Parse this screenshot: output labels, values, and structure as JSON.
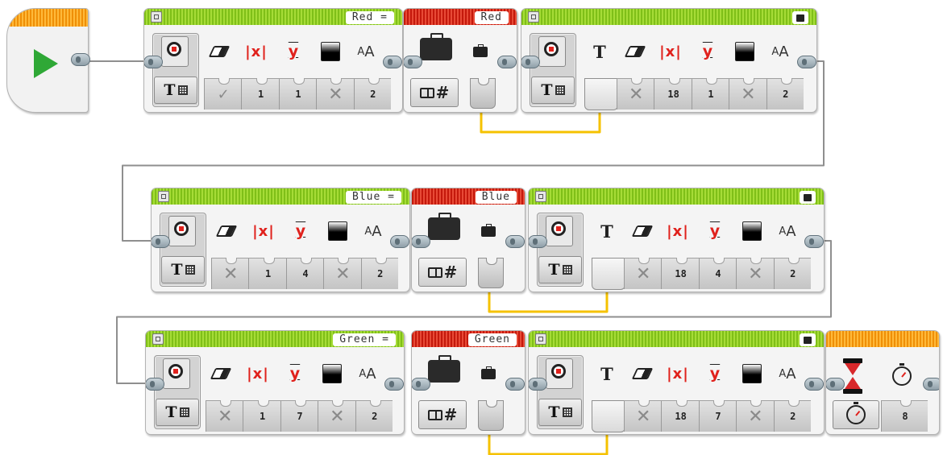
{
  "program": {
    "start_block": {
      "icon": "play-icon"
    },
    "rows": [
      {
        "display_a": {
          "header": "Red =",
          "params": [
            "✓",
            "1",
            "1",
            "✕",
            "2"
          ]
        },
        "variable": {
          "name": "Red"
        },
        "display_b": {
          "params": [
            "✕",
            "18",
            "1",
            "✕",
            "2"
          ]
        }
      },
      {
        "display_a": {
          "header": "Blue =",
          "params": [
            "✕",
            "1",
            "4",
            "✕",
            "2"
          ]
        },
        "variable": {
          "name": "Blue"
        },
        "display_b": {
          "params": [
            "✕",
            "18",
            "4",
            "✕",
            "2"
          ]
        }
      },
      {
        "display_a": {
          "header": "Green =",
          "params": [
            "✕",
            "1",
            "7",
            "✕",
            "2"
          ]
        },
        "variable": {
          "name": "Green"
        },
        "display_b": {
          "params": [
            "✕",
            "18",
            "7",
            "✕",
            "2"
          ]
        }
      }
    ],
    "wait_block": {
      "seconds": "8"
    }
  },
  "icons": {
    "display_a_icons": [
      "eraser-icon",
      "x-position-icon",
      "y-position-icon",
      "color-icon",
      "font-size-icon"
    ],
    "display_b_icons": [
      "text-icon",
      "eraser-icon",
      "x-position-icon",
      "y-position-icon",
      "color-icon",
      "font-size-icon"
    ],
    "variable_icons": [
      "briefcase-icon",
      "small-briefcase-icon"
    ],
    "mode_text_grid": "T",
    "mode_book_hash": "#",
    "glyph_T": "T",
    "glyph_x": "|x|",
    "glyph_y": "y",
    "glyph_aA_small": "A",
    "glyph_aA_big": "A"
  },
  "colors": {
    "display_header": "#8bc927",
    "variable_header": "#d3261a",
    "start_header": "#f5a21a",
    "wire": "#8f8f8f",
    "data_wire": "#f5c200",
    "port": "#9fb0b8"
  }
}
